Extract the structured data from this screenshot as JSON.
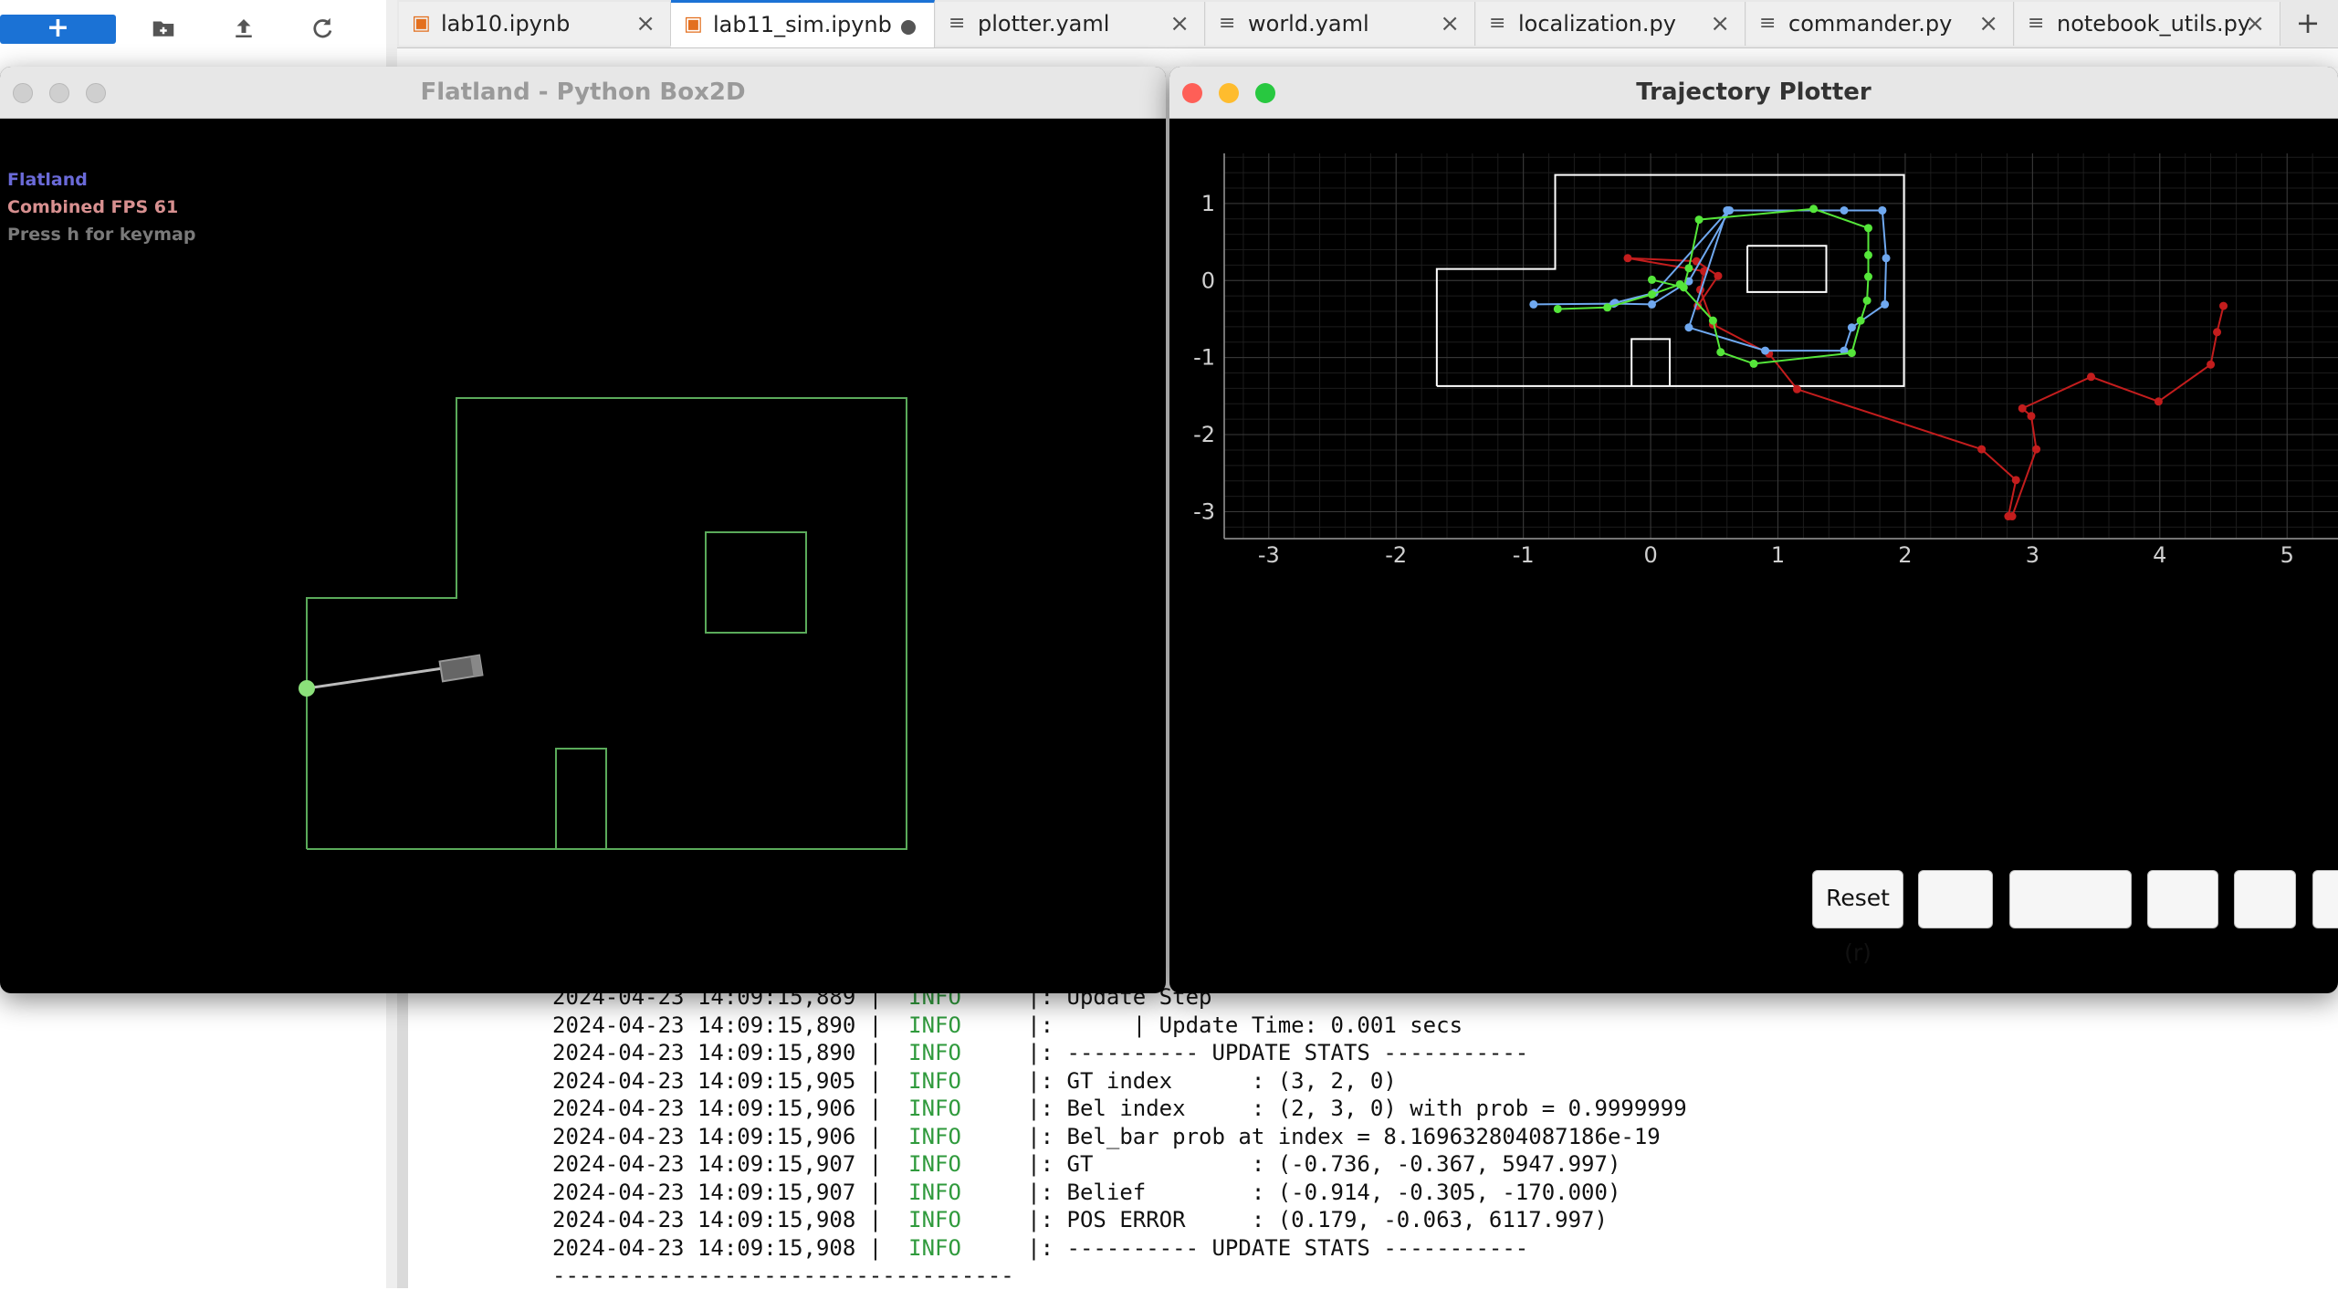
{
  "filebrowser": {
    "new_label": "+",
    "icons": [
      "new-folder-icon",
      "upload-icon",
      "refresh-icon"
    ]
  },
  "tabs": [
    {
      "label": "lab10.ipynb",
      "icon": "notebook-icon",
      "state": "close"
    },
    {
      "label": "lab11_sim.ipynb",
      "icon": "notebook-icon",
      "state": "modified",
      "active": true
    },
    {
      "label": "plotter.yaml",
      "icon": "file-icon",
      "state": "close"
    },
    {
      "label": "world.yaml",
      "icon": "file-icon",
      "state": "close"
    },
    {
      "label": "localization.py",
      "icon": "file-icon",
      "state": "close"
    },
    {
      "label": "commander.py",
      "icon": "file-icon",
      "state": "close"
    },
    {
      "label": "notebook_utils.py",
      "icon": "file-icon",
      "state": "close"
    }
  ],
  "flatland": {
    "title": "Flatland - Python Box2D",
    "hud": {
      "name": "Flatland",
      "fps": "Combined FPS 61",
      "help": "Press h for keymap"
    },
    "colors": {
      "wall": "#5aaa5a",
      "hud_name": "#6a6ad8",
      "hud_fps": "#d89090",
      "hud_help": "#7a7a7a",
      "sensor": "#8be07a"
    }
  },
  "plotter": {
    "title": "Trajectory Plotter",
    "buttons": [
      "Reset (r)",
      "",
      "",
      "",
      "",
      ""
    ],
    "colors": {
      "gt": "#6fa8ef",
      "belief": "#55e63a",
      "odom": "#c31d1d",
      "map": "#ffffff",
      "grid": "#3a3a3a"
    }
  },
  "chart_data": {
    "type": "line",
    "title": "",
    "xlabel": "",
    "ylabel": "",
    "xlim": [
      -3.35,
      5.4
    ],
    "ylim": [
      -3.35,
      1.65
    ],
    "xticks": [
      "-3",
      "-2",
      "-1",
      "0",
      "1",
      "2",
      "3",
      "4",
      "5"
    ],
    "yticks": [
      "1",
      "0",
      "-1",
      "-2",
      "-3"
    ],
    "grid": true,
    "map_lines": [
      [
        [
          -1.68,
          -1.37
        ],
        [
          -1.68,
          0.15
        ],
        [
          -0.75,
          0.15
        ],
        [
          -0.75,
          1.37
        ],
        [
          1.99,
          1.37
        ],
        [
          1.99,
          -1.37
        ],
        [
          -1.68,
          -1.37
        ]
      ],
      [
        [
          0.76,
          0.45
        ],
        [
          1.38,
          0.45
        ],
        [
          1.38,
          -0.15
        ],
        [
          0.76,
          -0.15
        ],
        [
          0.76,
          0.45
        ]
      ],
      [
        [
          -0.15,
          -1.37
        ],
        [
          -0.15,
          -0.76
        ],
        [
          0.15,
          -0.76
        ],
        [
          0.15,
          -1.37
        ]
      ]
    ],
    "series": [
      {
        "color": "#c31d1d",
        "x": [
          0.37,
          0.53,
          0.36,
          -0.18,
          0.42,
          0.39,
          0.49,
          0.93,
          1.15,
          2.6,
          2.87,
          2.81,
          2.84,
          3.03,
          2.99,
          2.92,
          3.46,
          3.99,
          4.4,
          4.45,
          4.5
        ],
        "y": [
          -0.33,
          0.06,
          0.25,
          0.29,
          0.12,
          -0.12,
          -0.57,
          -0.95,
          -1.41,
          -2.19,
          -2.59,
          -3.06,
          -3.06,
          -2.19,
          -1.76,
          -1.66,
          -1.25,
          -1.57,
          -1.09,
          -0.67,
          -0.33
        ]
      },
      {
        "color": "#6fa8ef",
        "x": [
          -0.92,
          -0.29,
          0.01,
          0.3,
          0.62,
          0.6,
          0.3,
          0.9,
          1.52,
          1.58,
          1.84,
          1.85,
          1.82,
          1.82,
          1.52,
          0.61,
          0.03,
          -0.28
        ],
        "y": [
          -0.31,
          -0.3,
          -0.31,
          -0.01,
          0.91,
          0.91,
          -0.61,
          -0.91,
          -0.91,
          -0.61,
          -0.31,
          0.29,
          0.91,
          0.91,
          0.91,
          0.91,
          -0.16,
          -0.29
        ]
      },
      {
        "color": "#55e63a",
        "x": [
          -0.73,
          -0.34,
          0.01,
          0.23,
          0.49,
          0.55,
          0.81,
          1.58,
          1.65,
          1.7,
          1.71,
          1.71,
          1.71,
          1.28,
          0.38,
          0.3,
          0.26,
          0.01
        ],
        "y": [
          -0.37,
          -0.35,
          -0.18,
          -0.05,
          -0.52,
          -0.93,
          -1.08,
          -0.94,
          -0.52,
          -0.26,
          0.05,
          0.33,
          0.68,
          0.93,
          0.79,
          0.16,
          -0.09,
          0.01
        ]
      }
    ]
  },
  "log": {
    "lines": [
      {
        "ts": "2024-04-23 14:09:15,889",
        "level": "INFO",
        "msg": "|: Update Step"
      },
      {
        "ts": "2024-04-23 14:09:15,890",
        "level": "INFO",
        "msg": "|:      | Update Time: 0.001 secs"
      },
      {
        "ts": "2024-04-23 14:09:15,890",
        "level": "INFO",
        "msg": "|: ---------- UPDATE STATS -----------"
      },
      {
        "ts": "2024-04-23 14:09:15,905",
        "level": "INFO",
        "msg": "|: GT index      : (3, 2, 0)"
      },
      {
        "ts": "2024-04-23 14:09:15,906",
        "level": "INFO",
        "msg": "|: Bel index     : (2, 3, 0) with prob = 0.9999999"
      },
      {
        "ts": "2024-04-23 14:09:15,906",
        "level": "INFO",
        "msg": "|: Bel_bar prob at index = 8.169632804087186e-19"
      },
      {
        "ts": "2024-04-23 14:09:15,907",
        "level": "INFO",
        "msg": "|: GT            : (-0.736, -0.367, 5947.997)"
      },
      {
        "ts": "2024-04-23 14:09:15,907",
        "level": "INFO",
        "msg": "|: Belief        : (-0.914, -0.305, -170.000)"
      },
      {
        "ts": "2024-04-23 14:09:15,908",
        "level": "INFO",
        "msg": "|: POS ERROR     : (0.179, -0.063, 6117.997)"
      },
      {
        "ts": "2024-04-23 14:09:15,908",
        "level": "INFO",
        "msg": "|: ---------- UPDATE STATS -----------"
      }
    ],
    "separator": "-----------------------------------"
  }
}
